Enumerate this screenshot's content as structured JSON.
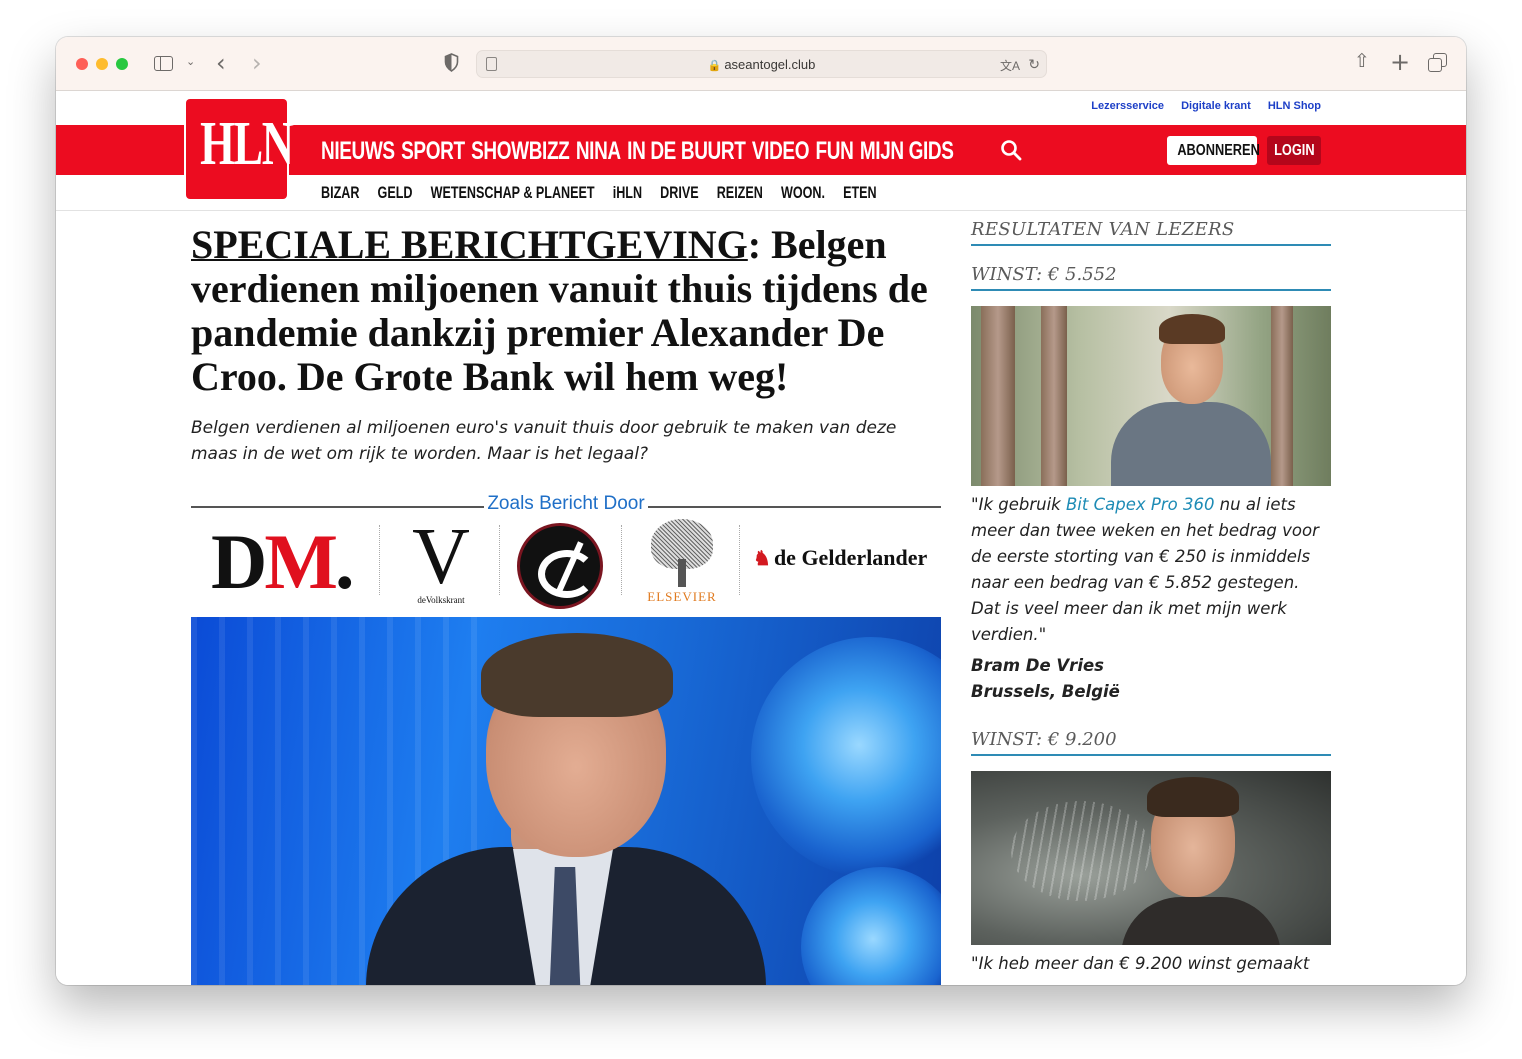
{
  "browser": {
    "url": "aseantogel.club"
  },
  "header": {
    "util_links": [
      "Lezersservice",
      "Digitale krant",
      "HLN Shop"
    ],
    "logo_text": "HLN",
    "main_nav": [
      "NIEUWS",
      "SPORT",
      "SHOWBIZZ",
      "NINA",
      "IN DE BUURT",
      "VIDEO",
      "FUN",
      "MIJN GIDS"
    ],
    "subscribe_label": "ABONNEREN",
    "login_label": "LOGIN",
    "sub_nav": [
      "BIZAR",
      "GELD",
      "WETENSCHAP & PLANEET",
      "iHLN",
      "DRIVE",
      "REIZEN",
      "WOON.",
      "ETEN"
    ]
  },
  "article": {
    "kicker": "SPECIALE BERICHTGEVING",
    "headline": ": Belgen verdienen miljoenen vanuit thuis tijdens de pandemie dankzij premier Alexander De Croo. De Grote Bank wil hem weg!",
    "lead": "Belgen verdienen al miljoenen euro's vanuit thuis door gebruik te maken van deze maas in de wet om rijk te worden. Maar is het legaal?",
    "as_seen_title": "Zoals Bericht Door",
    "press": {
      "dm_d": "D",
      "dm_m": "M",
      "dm_dot": ".",
      "vk_letter": "V",
      "vk_name": "deVolkskrant",
      "elsevier": "ELSEVIER",
      "gelderlander": "de Gelderlander"
    }
  },
  "sidebar": {
    "title": "RESULTATEN VAN LEZERS",
    "testimonials": [
      {
        "heading": "WINST: € 5.552",
        "quote_pre": "\"Ik gebruik ",
        "quote_link": "Bit Capex Pro 360",
        "quote_post": " nu al iets meer dan twee weken en het bedrag voor de eerste storting van € 250 is inmiddels naar een bedrag van € 5.852 gestegen. Dat is veel meer dan ik met mijn werk verdien.\"",
        "name": "Bram De Vries",
        "location": "Brussels, België"
      },
      {
        "heading": "WINST: € 9.200",
        "quote_pre": "\"Ik heb meer dan € 9.200 winst gemaakt"
      }
    ]
  }
}
